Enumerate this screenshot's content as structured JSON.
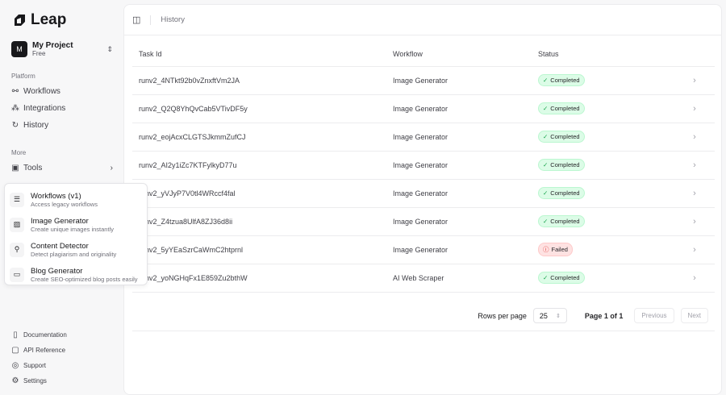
{
  "brand": "Leap",
  "project": {
    "initial": "M",
    "name": "My Project",
    "plan": "Free"
  },
  "sidebar": {
    "platform_label": "Platform",
    "platform": [
      {
        "label": "Workflows",
        "icon": "workflow-icon"
      },
      {
        "label": "Integrations",
        "icon": "integrations-icon"
      },
      {
        "label": "History",
        "icon": "history-icon"
      }
    ],
    "more_label": "More",
    "tools": "Tools",
    "footer": [
      {
        "label": "Documentation",
        "icon": "book-icon"
      },
      {
        "label": "API Reference",
        "icon": "api-icon"
      },
      {
        "label": "Support",
        "icon": "support-icon"
      },
      {
        "label": "Settings",
        "icon": "gear-icon"
      }
    ]
  },
  "tools_menu": [
    {
      "title": "Workflows (v1)",
      "desc": "Access legacy workflows",
      "icon": "list-icon"
    },
    {
      "title": "Image Generator",
      "desc": "Create unique images instantly",
      "icon": "image-icon"
    },
    {
      "title": "Content Detector",
      "desc": "Detect plagiarism and originality",
      "icon": "search-icon"
    },
    {
      "title": "Blog Generator",
      "desc": "Create SEO-optimized blog posts easily",
      "icon": "book-icon"
    }
  ],
  "header": {
    "breadcrumb": "History"
  },
  "table": {
    "columns": [
      "Task Id",
      "Workflow",
      "Status"
    ],
    "rows": [
      {
        "id": "runv2_4NTkt92b0vZnxftVm2JA",
        "workflow": "Image Generator",
        "status": "Completed"
      },
      {
        "id": "runv2_Q2Q8YhQvCab5VTivDF5y",
        "workflow": "Image Generator",
        "status": "Completed"
      },
      {
        "id": "runv2_eojAcxCLGTSJkmmZufCJ",
        "workflow": "Image Generator",
        "status": "Completed"
      },
      {
        "id": "runv2_AI2y1iZc7KTFylkyD77u",
        "workflow": "Image Generator",
        "status": "Completed"
      },
      {
        "id": "runv2_yVJyP7V0tl4WRccf4fal",
        "workflow": "Image Generator",
        "status": "Completed"
      },
      {
        "id": "runv2_Z4tzua8UlfA8ZJ36d8ii",
        "workflow": "Image Generator",
        "status": "Completed"
      },
      {
        "id": "runv2_5yYEaSzrCaWmC2htprnl",
        "workflow": "Image Generator",
        "status": "Failed"
      },
      {
        "id": "runv2_yoNGHqFx1E859Zu2bthW",
        "workflow": "AI Web Scraper",
        "status": "Completed"
      }
    ]
  },
  "pagination": {
    "rows_label": "Rows per page",
    "rows_value": "25",
    "page": "Page 1 of 1",
    "prev": "Previous",
    "next": "Next"
  }
}
